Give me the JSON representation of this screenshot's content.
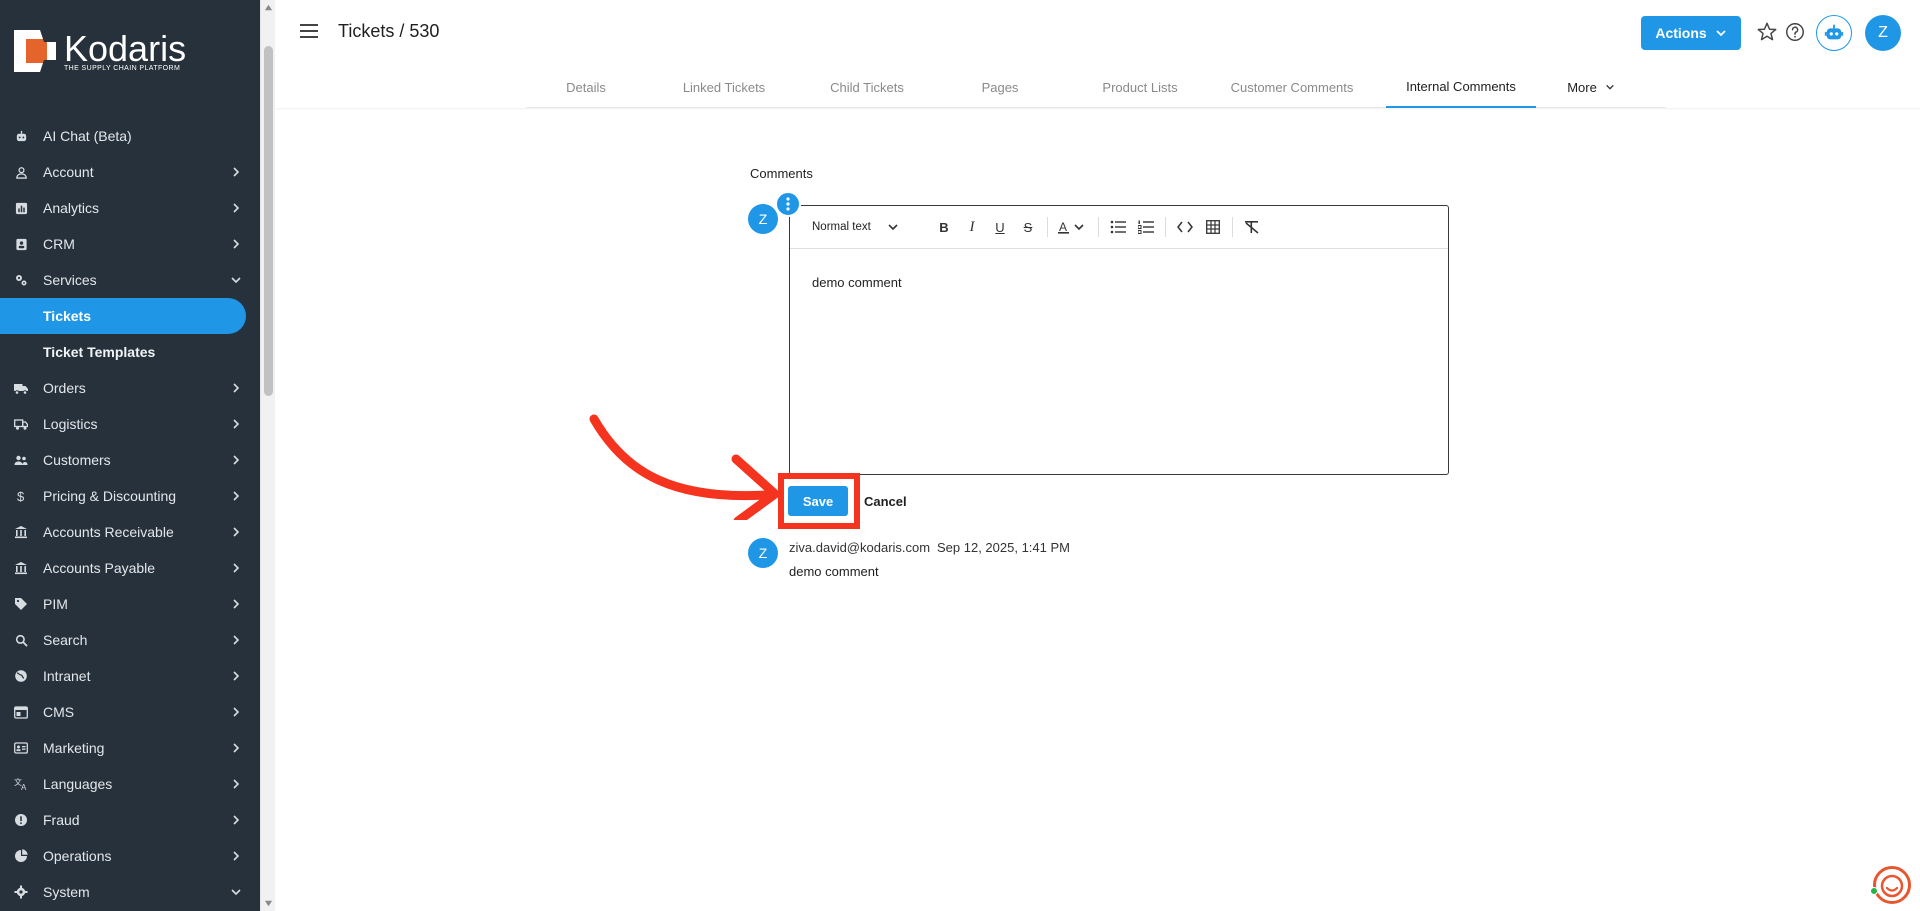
{
  "brand": {
    "name": "Kodaris",
    "tagline": "THE SUPPLY CHAIN PLATFORM",
    "accent": "#1f97e6",
    "sidebar_bg": "#27313b",
    "logo_orange": "#e4642b"
  },
  "sidebar": {
    "items": [
      {
        "label": "AI Chat (Beta)",
        "icon": "robot-icon",
        "chevron": "none"
      },
      {
        "label": "Account",
        "icon": "person-icon",
        "chevron": "right"
      },
      {
        "label": "Analytics",
        "icon": "chart-icon",
        "chevron": "right"
      },
      {
        "label": "CRM",
        "icon": "contact-icon",
        "chevron": "right"
      },
      {
        "label": "Services",
        "icon": "gears-icon",
        "chevron": "down"
      },
      {
        "label": "Tickets",
        "icon": "",
        "chevron": "none",
        "sub": true,
        "active": true
      },
      {
        "label": "Ticket Templates",
        "icon": "",
        "chevron": "none",
        "sub": true
      },
      {
        "label": "Orders",
        "icon": "truck-icon",
        "chevron": "right"
      },
      {
        "label": "Logistics",
        "icon": "shipping-icon",
        "chevron": "right"
      },
      {
        "label": "Customers",
        "icon": "people-icon",
        "chevron": "right"
      },
      {
        "label": "Pricing & Discounting",
        "icon": "dollar-icon",
        "chevron": "right"
      },
      {
        "label": "Accounts Receivable",
        "icon": "bank-icon",
        "chevron": "right"
      },
      {
        "label": "Accounts Payable",
        "icon": "bank-icon",
        "chevron": "right"
      },
      {
        "label": "PIM",
        "icon": "tag-icon",
        "chevron": "right"
      },
      {
        "label": "Search",
        "icon": "search-icon",
        "chevron": "right"
      },
      {
        "label": "Intranet",
        "icon": "globe-icon",
        "chevron": "right"
      },
      {
        "label": "CMS",
        "icon": "web-icon",
        "chevron": "right"
      },
      {
        "label": "Marketing",
        "icon": "card-icon",
        "chevron": "right"
      },
      {
        "label": "Languages",
        "icon": "translate-icon",
        "chevron": "right"
      },
      {
        "label": "Fraud",
        "icon": "alert-icon",
        "chevron": "right"
      },
      {
        "label": "Operations",
        "icon": "pie-icon",
        "chevron": "right"
      },
      {
        "label": "System",
        "icon": "settings-icon",
        "chevron": "down"
      }
    ]
  },
  "header": {
    "title": "Tickets / 530",
    "actions_label": "Actions",
    "user_initial": "Z"
  },
  "tabs": [
    {
      "label": "Details"
    },
    {
      "label": "Linked Tickets"
    },
    {
      "label": "Child Tickets"
    },
    {
      "label": "Pages"
    },
    {
      "label": "Product Lists"
    },
    {
      "label": "Customer Comments"
    },
    {
      "label": "Internal Comments",
      "active": true
    },
    {
      "label": "More"
    }
  ],
  "comments": {
    "section_label": "Comments",
    "avatar_initial": "Z",
    "editor": {
      "format_select": "Normal text",
      "content": "demo comment"
    },
    "save_label": "Save",
    "cancel_label": "Cancel",
    "entries": [
      {
        "initial": "Z",
        "author": "ziva.david@kodaris.com",
        "date": "Sep 12, 2025, 1:41 PM",
        "body": "demo comment"
      }
    ]
  },
  "annotation": {
    "color": "#f5341f"
  }
}
